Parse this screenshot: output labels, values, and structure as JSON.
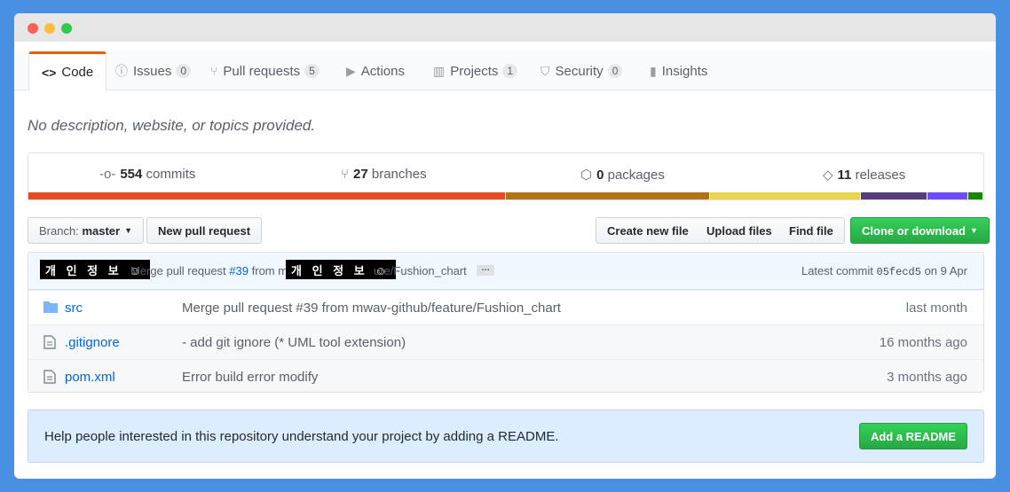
{
  "tabs": [
    {
      "label": "Code",
      "icon": "code-icon",
      "counter": null
    },
    {
      "label": "Issues",
      "icon": "issue-icon",
      "counter": "0"
    },
    {
      "label": "Pull requests",
      "icon": "pull-request-icon",
      "counter": "5"
    },
    {
      "label": "Actions",
      "icon": "play-icon",
      "counter": null
    },
    {
      "label": "Projects",
      "icon": "project-icon",
      "counter": "1"
    },
    {
      "label": "Security",
      "icon": "shield-icon",
      "counter": "0"
    },
    {
      "label": "Insights",
      "icon": "graph-icon",
      "counter": null
    }
  ],
  "description": "No description, website, or topics provided.",
  "stats": {
    "commits_count": "554",
    "commits_label": "commits",
    "branches_count": "27",
    "branches_label": "branches",
    "packages_count": "0",
    "packages_label": "packages",
    "releases_count": "11",
    "releases_label": "releases"
  },
  "language_bar": [
    {
      "color": "#e34c26",
      "share": 0.502
    },
    {
      "color": "#b07219",
      "share": 0.214
    },
    {
      "color": "#e8d44d",
      "share": 0.158
    },
    {
      "color": "#563d7c",
      "share": 0.069
    },
    {
      "color": "#6e4cf7",
      "share": 0.042
    },
    {
      "color": "#178600",
      "share": 0.015
    }
  ],
  "toolbar": {
    "branch_prefix": "Branch:",
    "branch_name": "master",
    "new_pr": "New pull request",
    "create_file": "Create new file",
    "upload_files": "Upload files",
    "find_file": "Find file",
    "clone": "Clone or download"
  },
  "commit": {
    "redacted_label": "개 인 정 보 ☺",
    "msg_prefix": "Merge pull request",
    "pr_link": "#39",
    "msg_from": "from m",
    "msg_suffix": "ure/Fushion_chart",
    "ellipsis": "…",
    "latest_label": "Latest commit",
    "sha": "05fecd5",
    "date": "on 9 Apr"
  },
  "files": [
    {
      "name": "src",
      "type": "folder",
      "message": "Merge pull request #39 from mwav-github/feature/Fushion_chart",
      "age": "last month"
    },
    {
      "name": ".gitignore",
      "type": "file",
      "message": "- add git ignore (* UML tool extension)",
      "age": "16 months ago"
    },
    {
      "name": "pom.xml",
      "type": "file",
      "message": "Error build error modify",
      "age": "3 months ago"
    }
  ],
  "readme": {
    "text": "Help people interested in this repository understand your project by adding a README.",
    "button": "Add a README"
  },
  "colors": {
    "accent": "#e36209",
    "link": "#0366d6",
    "green": "#28a745",
    "background": "#4a90e2"
  }
}
